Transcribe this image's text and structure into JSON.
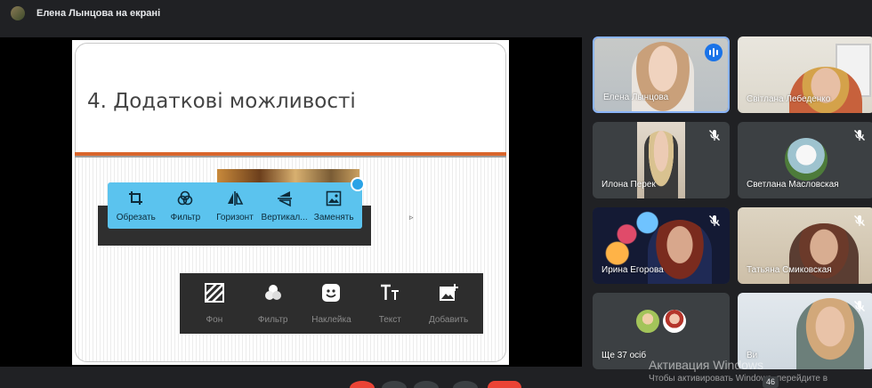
{
  "header": {
    "presenter_title": "Елена Лынцова на екрані"
  },
  "slide": {
    "title": "4. Додаткові можливості",
    "edit_toolbar": [
      {
        "label": "Обрезать",
        "icon": "crop-icon"
      },
      {
        "label": "Фильтр",
        "icon": "filter-icon"
      },
      {
        "label": "Горизонт",
        "icon": "flip-horizontal-icon"
      },
      {
        "label": "Вертикал...",
        "icon": "flip-vertical-icon"
      },
      {
        "label": "Заменять",
        "icon": "image-replace-icon"
      }
    ],
    "story_toolbar": [
      {
        "label": "Фон",
        "icon": "background-icon"
      },
      {
        "label": "Фильтр",
        "icon": "filter-icon"
      },
      {
        "label": "Наклейка",
        "icon": "sticker-icon"
      },
      {
        "label": "Текст",
        "icon": "text-icon"
      },
      {
        "label": "Добавить",
        "icon": "add-image-icon"
      }
    ]
  },
  "participants": [
    {
      "name": "Елена Лынцова",
      "speaking": true,
      "muted": false
    },
    {
      "name": "Світлана Лебеденко",
      "muted": false
    },
    {
      "name": "Илона Перек",
      "muted": true
    },
    {
      "name": "Светлана Масловская",
      "muted": true
    },
    {
      "name": "Ирина Егорова",
      "muted": true
    },
    {
      "name": "Татьяна Смиковская",
      "muted": true
    },
    {
      "name": "Ще 37 осіб",
      "muted": false
    },
    {
      "name": "Ви",
      "muted": true
    }
  ],
  "watermark": {
    "line1": "Активация Windows",
    "line2": "Чтобы активировать Windows, перейдите в"
  },
  "participant_count": "46",
  "colors": {
    "accent_blue": "#1a73e8",
    "slide_rule": "#d9652b",
    "toolbar_blue": "#5bc3ee",
    "end_call_red": "#ea4335"
  }
}
